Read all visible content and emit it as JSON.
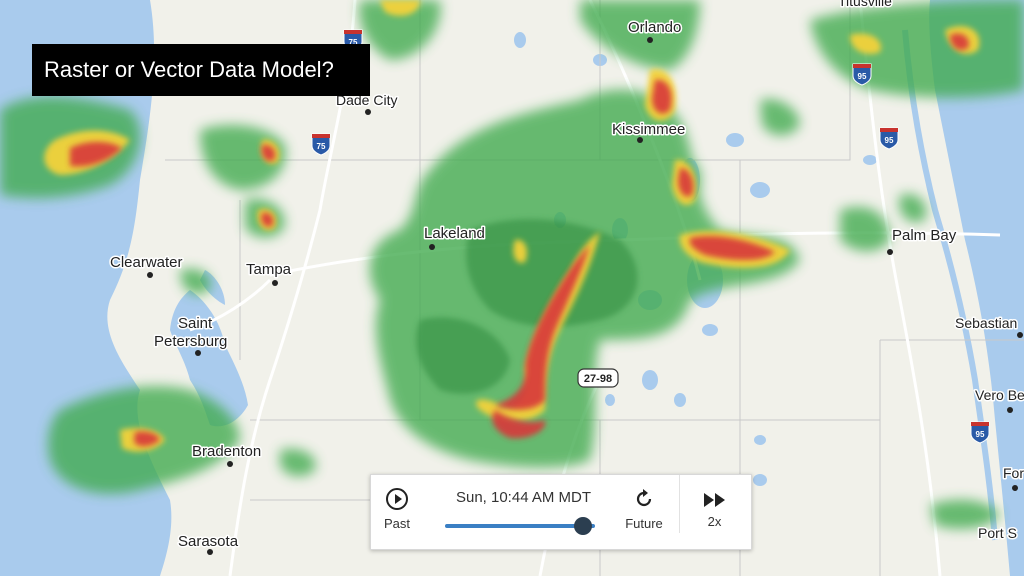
{
  "title": "Raster or Vector Data Model?",
  "cities": {
    "titusville": "Titusville",
    "orlando": "Orlando",
    "dade_city": "Dade City",
    "kissimmee": "Kissimmee",
    "lakeland": "Lakeland",
    "palm_bay": "Palm Bay",
    "clearwater": "Clearwater",
    "tampa": "Tampa",
    "saint": "Saint",
    "petersburg": "Petersburg",
    "sebastian": "Sebastian",
    "vero_beach": "Vero Be",
    "bradenton": "Bradenton",
    "fort": "For",
    "sarasota": "Sarasota",
    "port": "Port S"
  },
  "shields": {
    "i75_top": "75",
    "i75_mid": "75",
    "i95_top": "95",
    "i95_mid": "95",
    "i95_low": "95",
    "us2798": "27-98"
  },
  "player": {
    "time": "Sun, 10:44 AM MDT",
    "past_label": "Past",
    "future_label": "Future",
    "speed_label": "2x",
    "progress": 0.92
  },
  "colors": {
    "water": "#a9cbed",
    "land": "#f1f1ea",
    "radar_green": "#3faa4e",
    "radar_yellow": "#f3d23a",
    "radar_red": "#d8393a"
  }
}
